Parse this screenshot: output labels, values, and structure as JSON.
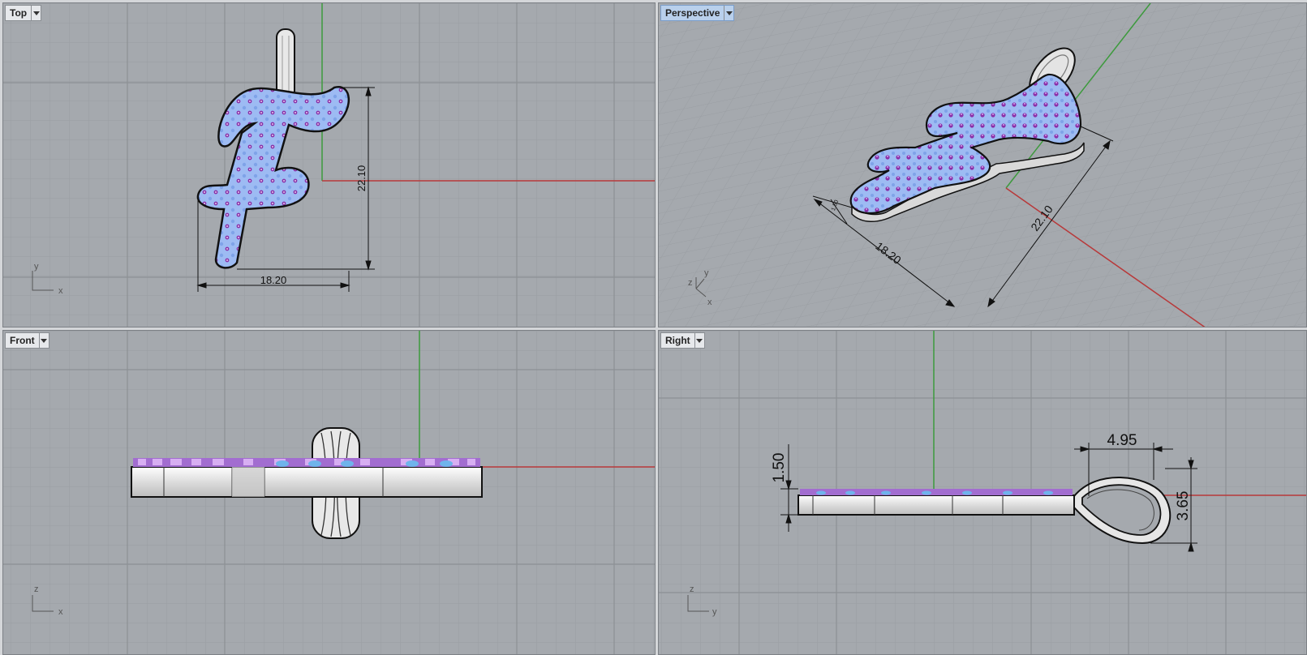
{
  "viewports": {
    "top": {
      "title": "Top",
      "dims": {
        "width": "18.20",
        "height": "22.10"
      },
      "axes": {
        "a": "x",
        "b": "y"
      }
    },
    "perspective": {
      "title": "Perspective",
      "dims": {
        "width": "18.20",
        "height": "22.10",
        "thickness": "1.50"
      },
      "axes": {
        "a": "x",
        "b": "y",
        "c": "z"
      }
    },
    "front": {
      "title": "Front",
      "axes": {
        "a": "x",
        "b": "z"
      }
    },
    "right": {
      "title": "Right",
      "dims": {
        "thickness": "1.50",
        "bail_width": "4.95",
        "bail_height": "3.65"
      },
      "axes": {
        "a": "y",
        "b": "z"
      }
    }
  },
  "colors": {
    "viewport_bg": "#a5a9ae",
    "grid_minor": "#999da2",
    "grid_major": "#8c9095",
    "x_axis": "#b8393a",
    "y_axis": "#3d9a3d",
    "gem_fill": "#9dbbf3",
    "gem_stone": "#8a2fa8",
    "metal": "#e2e2e2",
    "active_title": "#b9d0ec"
  },
  "icons": [
    "dropdown-caret-icon",
    "axis-triad-icon"
  ]
}
